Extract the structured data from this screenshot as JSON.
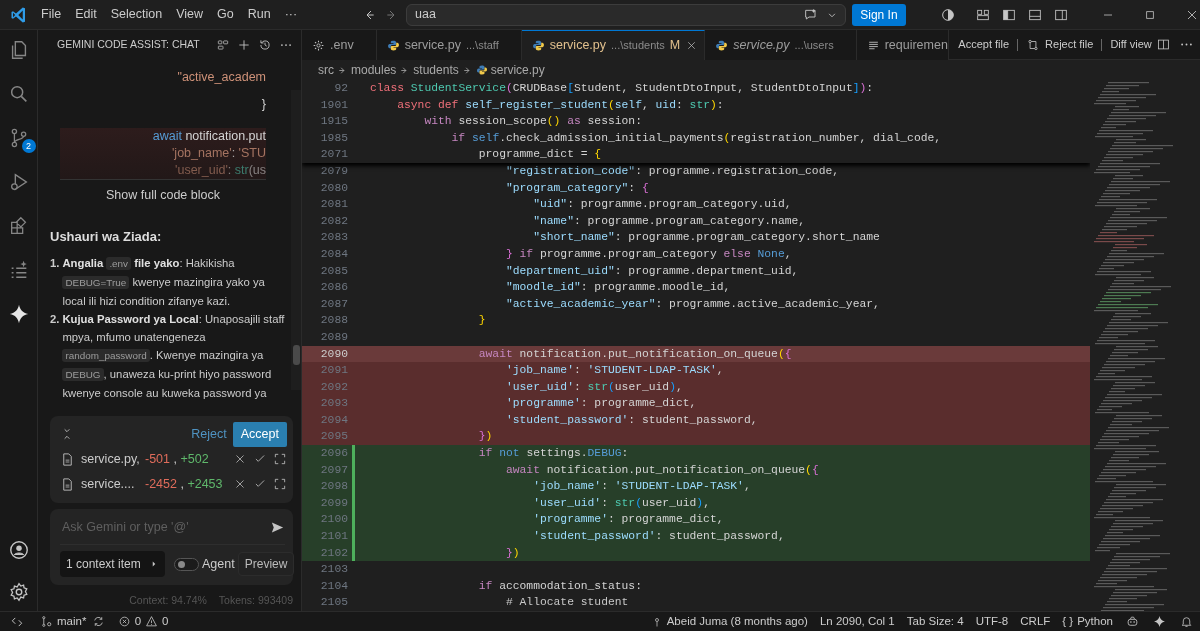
{
  "title_bar": {
    "menu": [
      "File",
      "Edit",
      "Selection",
      "View",
      "Go",
      "Run",
      "···"
    ],
    "search": {
      "value": "uaa"
    },
    "sign_in": "Sign In"
  },
  "activity_bar": [
    {
      "kind": "files",
      "selected": false
    },
    {
      "kind": "search",
      "selected": false
    },
    {
      "kind": "source-control",
      "selected": false,
      "badge": "2"
    },
    {
      "kind": "debug",
      "selected": false
    },
    {
      "kind": "extensions",
      "selected": false
    },
    {
      "kind": "testing",
      "selected": false
    },
    {
      "kind": "sparkle",
      "selected": true
    }
  ],
  "activity_bottom": [
    {
      "kind": "account"
    },
    {
      "kind": "settings"
    }
  ],
  "chat": {
    "title": "GEMINI CODE ASSIST: CHAT",
    "snippet_lines": [
      [
        {
          "kind": "literal",
          "text": "\"active_academ"
        }
      ],
      [
        {
          "kind": "plain",
          "text": "}"
        }
      ]
    ],
    "snippet_diff": [
      [
        {
          "kind": "constant",
          "text": "await "
        },
        {
          "kind": "plain",
          "text": "notification.put"
        }
      ],
      [
        {
          "kind": "literal",
          "text": "'job_name'"
        },
        {
          "kind": "plain",
          "text": ": "
        },
        {
          "kind": "literal",
          "text": "'STU"
        }
      ],
      [
        {
          "kind": "literal",
          "text": "'user_uid'"
        },
        {
          "kind": "plain",
          "text": ": "
        },
        {
          "kind": "type",
          "text": "str"
        },
        {
          "kind": "plain",
          "text": "(us"
        }
      ]
    ],
    "show_more": "Show full code block",
    "heading": "Ushauri wa Ziada:",
    "tips": [
      {
        "marker": "1.",
        "segments": [
          {
            "kind": "bold",
            "text": "Angalia "
          },
          {
            "kind": "code",
            "text": ".env"
          },
          {
            "kind": "bold",
            "text": " file yako"
          },
          {
            "kind": "text",
            "text": ": Hakikisha "
          },
          {
            "kind": "code",
            "text": "DEBUG=True"
          },
          {
            "kind": "text",
            "text": " kwenye mazingira yako ya local ili hizi condition zifanye kazi."
          }
        ]
      },
      {
        "marker": "2.",
        "segments": [
          {
            "kind": "bold",
            "text": "Kujua Password ya Local"
          },
          {
            "kind": "text",
            "text": ": Unaposajili staff mpya, mfumo unatengeneza "
          },
          {
            "kind": "code",
            "text": "random_password"
          },
          {
            "kind": "text",
            "text": ". Kwenye mazingira ya "
          },
          {
            "kind": "code",
            "text": "DEBUG"
          },
          {
            "kind": "text",
            "text": ", unaweza ku-print hiyo password kwenye console au kuweka password ya"
          }
        ]
      }
    ],
    "changes": {
      "reject": "Reject",
      "accept": "Accept",
      "files": [
        {
          "name": "service.py,",
          "removed": "-501",
          "separator": ",",
          "added": "+502"
        },
        {
          "name": "service....",
          "removed": "-2452",
          "separator": ",",
          "added": "+2453"
        }
      ]
    },
    "prompt": {
      "placeholder": "Ask Gemini or type '@'",
      "context": "1 context item",
      "agent": {
        "label": "Agent",
        "on": false
      },
      "preview": "Preview"
    },
    "usage": [
      "Context: 94.74%",
      "Tokens: 993409"
    ]
  },
  "editor": {
    "tabs": [
      {
        "kind": "settings",
        "label": ".env",
        "selected": false,
        "preview": false
      },
      {
        "kind": "python",
        "label": "service.py",
        "path": "...\\staff",
        "selected": false,
        "preview": false
      },
      {
        "kind": "python",
        "label": "service.py",
        "path": "...\\students",
        "status": "M",
        "selected": true,
        "preview": false
      },
      {
        "kind": "python",
        "label": "service.py",
        "path": "...\\users",
        "selected": false,
        "preview": true
      },
      {
        "kind": "text",
        "label": "requiremen",
        "selected": false,
        "preview": false
      }
    ],
    "actions": [
      {
        "kind": "accept",
        "label": "Accept file"
      },
      {
        "kind": "reject",
        "label": "Reject file"
      },
      {
        "kind": "diff",
        "label": "Diff view"
      }
    ],
    "breadcrumb": [
      "src",
      "modules",
      "students",
      "service.py"
    ],
    "sticky": [
      {
        "num": "92",
        "tokens": [
          {
            "kind": "declaration",
            "text": "class "
          },
          {
            "kind": "type",
            "text": "StudentService"
          },
          {
            "kind": "bracket2",
            "text": "("
          },
          {
            "kind": "plain",
            "text": "CRUDBase"
          },
          {
            "kind": "bracket3",
            "text": "["
          },
          {
            "kind": "plain",
            "text": "Student, StudentDtoInput, StudentDtoInput"
          },
          {
            "kind": "bracket3",
            "text": "]"
          },
          {
            "kind": "bracket2",
            "text": ")"
          },
          {
            "kind": "plain",
            "text": ":"
          }
        ]
      },
      {
        "num": "1901",
        "tokens": [
          {
            "kind": "declaration",
            "text": "    async def "
          },
          {
            "kind": "function",
            "text": "self_register_student"
          },
          {
            "kind": "bracket1",
            "text": "("
          },
          {
            "kind": "variable",
            "text": "self"
          },
          {
            "kind": "plain",
            "text": ", "
          },
          {
            "kind": "variable",
            "text": "uid"
          },
          {
            "kind": "plain",
            "text": ": "
          },
          {
            "kind": "type",
            "text": "str"
          },
          {
            "kind": "bracket1",
            "text": ")"
          },
          {
            "kind": "plain",
            "text": ":"
          }
        ]
      },
      {
        "num": "1915",
        "tokens": [
          {
            "kind": "keyword",
            "text": "        with "
          },
          {
            "kind": "plain",
            "text": "session_scope"
          },
          {
            "kind": "bracket1",
            "text": "()"
          },
          {
            "kind": "keyword",
            "text": " as "
          },
          {
            "kind": "plain",
            "text": "session:"
          }
        ]
      },
      {
        "num": "1985",
        "tokens": [
          {
            "kind": "keyword",
            "text": "            if "
          },
          {
            "kind": "constant",
            "text": "self"
          },
          {
            "kind": "plain",
            "text": ".check_admission_initial_payments"
          },
          {
            "kind": "bracket1",
            "text": "("
          },
          {
            "kind": "plain",
            "text": "registration_number, dial_code,"
          }
        ]
      },
      {
        "num": "2071",
        "tokens": [
          {
            "kind": "plain",
            "text": "                programme_dict = "
          },
          {
            "kind": "bracket1",
            "text": "{"
          }
        ]
      }
    ],
    "lines": [
      {
        "num": "2079",
        "removed": false,
        "added": false,
        "current": false,
        "tokens": [
          {
            "kind": "string",
            "text": "                    \"registration_code\""
          },
          {
            "kind": "plain",
            "text": ": programme.registration_code,"
          }
        ]
      },
      {
        "num": "2080",
        "removed": false,
        "added": false,
        "current": false,
        "tokens": [
          {
            "kind": "string",
            "text": "                    \"program_category\""
          },
          {
            "kind": "plain",
            "text": ": "
          },
          {
            "kind": "bracket2",
            "text": "{"
          }
        ]
      },
      {
        "num": "2081",
        "removed": false,
        "added": false,
        "current": false,
        "tokens": [
          {
            "kind": "string",
            "text": "                        \"uid\""
          },
          {
            "kind": "plain",
            "text": ": programme.program_category.uid,"
          }
        ]
      },
      {
        "num": "2082",
        "removed": false,
        "added": false,
        "current": false,
        "tokens": [
          {
            "kind": "string",
            "text": "                        \"name\""
          },
          {
            "kind": "plain",
            "text": ": programme.program_category.name,"
          }
        ]
      },
      {
        "num": "2083",
        "removed": false,
        "added": false,
        "current": false,
        "tokens": [
          {
            "kind": "string",
            "text": "                        \"short_name\""
          },
          {
            "kind": "plain",
            "text": ": programme.program_category.short_name"
          }
        ]
      },
      {
        "num": "2084",
        "removed": false,
        "added": false,
        "current": false,
        "tokens": [
          {
            "kind": "bracket2",
            "text": "                    }"
          },
          {
            "kind": "keyword",
            "text": " if "
          },
          {
            "kind": "plain",
            "text": "programme.program_category "
          },
          {
            "kind": "keyword",
            "text": "else "
          },
          {
            "kind": "constant",
            "text": "None"
          },
          {
            "kind": "plain",
            "text": ","
          }
        ]
      },
      {
        "num": "2085",
        "removed": false,
        "added": false,
        "current": false,
        "tokens": [
          {
            "kind": "string",
            "text": "                    \"department_uid\""
          },
          {
            "kind": "plain",
            "text": ": programme.department_uid,"
          }
        ]
      },
      {
        "num": "2086",
        "removed": false,
        "added": false,
        "current": false,
        "tokens": [
          {
            "kind": "string",
            "text": "                    \"moodle_id\""
          },
          {
            "kind": "plain",
            "text": ": programme.moodle_id,"
          }
        ]
      },
      {
        "num": "2087",
        "removed": false,
        "added": false,
        "current": false,
        "tokens": [
          {
            "kind": "string",
            "text": "                    \"active_academic_year\""
          },
          {
            "kind": "plain",
            "text": ": programme.active_academic_year,"
          }
        ]
      },
      {
        "num": "2088",
        "removed": false,
        "added": false,
        "current": false,
        "tokens": [
          {
            "kind": "bracket1",
            "text": "                }"
          }
        ]
      },
      {
        "num": "2089",
        "removed": false,
        "added": false,
        "current": false
      },
      {
        "num": "2090",
        "removed": true,
        "added": false,
        "current": true,
        "tokens": [
          {
            "kind": "keyword",
            "text": "                await "
          },
          {
            "kind": "plain",
            "text": "notification.put_notification_on_queue"
          },
          {
            "kind": "bracket1",
            "text": "("
          },
          {
            "kind": "bracket2",
            "text": "{"
          }
        ]
      },
      {
        "num": "2091",
        "removed": true,
        "added": false,
        "current": false,
        "tokens": [
          {
            "kind": "string",
            "text": "                    'job_name'"
          },
          {
            "kind": "plain",
            "text": ": "
          },
          {
            "kind": "string",
            "text": "'STUDENT-LDAP-TASK'"
          },
          {
            "kind": "plain",
            "text": ","
          }
        ]
      },
      {
        "num": "2092",
        "removed": true,
        "added": false,
        "current": false,
        "tokens": [
          {
            "kind": "string",
            "text": "                    'user_uid'"
          },
          {
            "kind": "plain",
            "text": ": "
          },
          {
            "kind": "type",
            "text": "str"
          },
          {
            "kind": "bracket3",
            "text": "("
          },
          {
            "kind": "plain",
            "text": "user_uid"
          },
          {
            "kind": "bracket3",
            "text": ")"
          },
          {
            "kind": "plain",
            "text": ","
          }
        ]
      },
      {
        "num": "2093",
        "removed": true,
        "added": false,
        "current": false,
        "tokens": [
          {
            "kind": "string",
            "text": "                    'programme'"
          },
          {
            "kind": "plain",
            "text": ": programme_dict,"
          }
        ]
      },
      {
        "num": "2094",
        "removed": true,
        "added": false,
        "current": false,
        "tokens": [
          {
            "kind": "string",
            "text": "                    'student_password'"
          },
          {
            "kind": "plain",
            "text": ": student_password,"
          }
        ]
      },
      {
        "num": "2095",
        "removed": true,
        "added": false,
        "current": false,
        "tokens": [
          {
            "kind": "bracket2",
            "text": "                }"
          },
          {
            "kind": "bracket1",
            "text": ")"
          }
        ]
      },
      {
        "num": "2096",
        "removed": false,
        "added": true,
        "current": false,
        "tokens": [
          {
            "kind": "keyword",
            "text": "                if "
          },
          {
            "kind": "constant",
            "text": "not "
          },
          {
            "kind": "plain",
            "text": "settings."
          },
          {
            "kind": "constant",
            "text": "DEBUG"
          },
          {
            "kind": "plain",
            "text": ":"
          }
        ]
      },
      {
        "num": "2097",
        "removed": false,
        "added": true,
        "current": false,
        "tokens": [
          {
            "kind": "keyword",
            "text": "                    await "
          },
          {
            "kind": "plain",
            "text": "notification.put_notification_on_queue"
          },
          {
            "kind": "bracket1",
            "text": "("
          },
          {
            "kind": "bracket2",
            "text": "{"
          }
        ]
      },
      {
        "num": "2098",
        "removed": false,
        "added": true,
        "current": false,
        "tokens": [
          {
            "kind": "string",
            "text": "                        'job_name'"
          },
          {
            "kind": "plain",
            "text": ": "
          },
          {
            "kind": "string",
            "text": "'STUDENT-LDAP-TASK'"
          },
          {
            "kind": "plain",
            "text": ","
          }
        ]
      },
      {
        "num": "2099",
        "removed": false,
        "added": true,
        "current": false,
        "tokens": [
          {
            "kind": "string",
            "text": "                        'user_uid'"
          },
          {
            "kind": "plain",
            "text": ": "
          },
          {
            "kind": "type",
            "text": "str"
          },
          {
            "kind": "bracket3",
            "text": "("
          },
          {
            "kind": "plain",
            "text": "user_uid"
          },
          {
            "kind": "bracket3",
            "text": ")"
          },
          {
            "kind": "plain",
            "text": ","
          }
        ]
      },
      {
        "num": "2100",
        "removed": false,
        "added": true,
        "current": false,
        "tokens": [
          {
            "kind": "string",
            "text": "                        'programme'"
          },
          {
            "kind": "plain",
            "text": ": programme_dict,"
          }
        ]
      },
      {
        "num": "2101",
        "removed": false,
        "added": true,
        "current": false,
        "tokens": [
          {
            "kind": "string",
            "text": "                        'student_password'"
          },
          {
            "kind": "plain",
            "text": ": student_password,"
          }
        ]
      },
      {
        "num": "2102",
        "removed": false,
        "added": true,
        "current": false,
        "tokens": [
          {
            "kind": "bracket2",
            "text": "                    }"
          },
          {
            "kind": "bracket1",
            "text": ")"
          }
        ]
      },
      {
        "num": "2103",
        "removed": false,
        "added": false,
        "current": false
      },
      {
        "num": "2104",
        "removed": false,
        "added": false,
        "current": false,
        "tokens": [
          {
            "kind": "keyword",
            "text": "                if "
          },
          {
            "kind": "plain",
            "text": "accommodation_status:"
          }
        ]
      },
      {
        "num": "2105",
        "removed": false,
        "added": false,
        "current": false,
        "tokens": [
          {
            "kind": "comment",
            "text": "                    # Allocate student"
          }
        ]
      }
    ]
  },
  "status_bar": {
    "branch": "main*",
    "errors": "0",
    "warnings": "0",
    "blame": "Abeid Juma (8 months ago)",
    "position": "Ln 2090, Col 1",
    "tab_size": "Tab Size: 4",
    "encoding": "UTF-8",
    "eol": "CRLF",
    "language_icon": "{ }",
    "language": "Python"
  }
}
